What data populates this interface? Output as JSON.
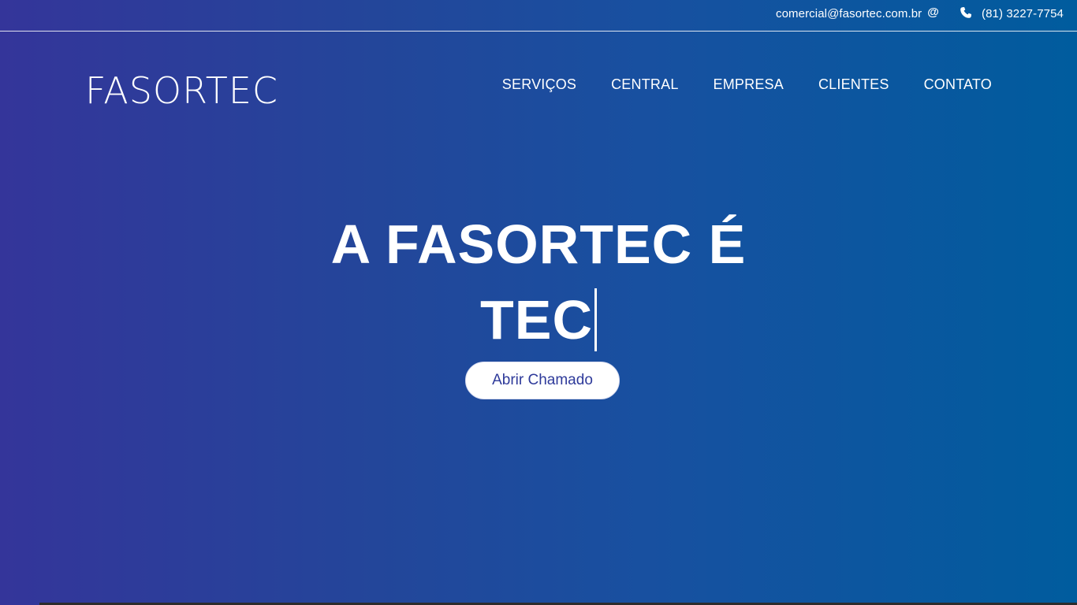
{
  "topbar": {
    "email": "comercial@fasortec.com.br",
    "email_icon": "at-icon",
    "phone_icon": "phone-icon",
    "phone": "(81) 3227-7754"
  },
  "header": {
    "logo": "FASORTEC",
    "nav": [
      {
        "label": "SERVIÇOS"
      },
      {
        "label": "CENTRAL"
      },
      {
        "label": "EMPRESA"
      },
      {
        "label": "CLIENTES"
      },
      {
        "label": "CONTATO"
      }
    ]
  },
  "hero": {
    "line1": "A FASORTEC É",
    "line2": "TEC",
    "cta_label": "Abrir Chamado"
  },
  "colors": {
    "gradient_start": "#34359a",
    "gradient_end": "#005c9e",
    "cta_text": "#2e3a9a"
  }
}
